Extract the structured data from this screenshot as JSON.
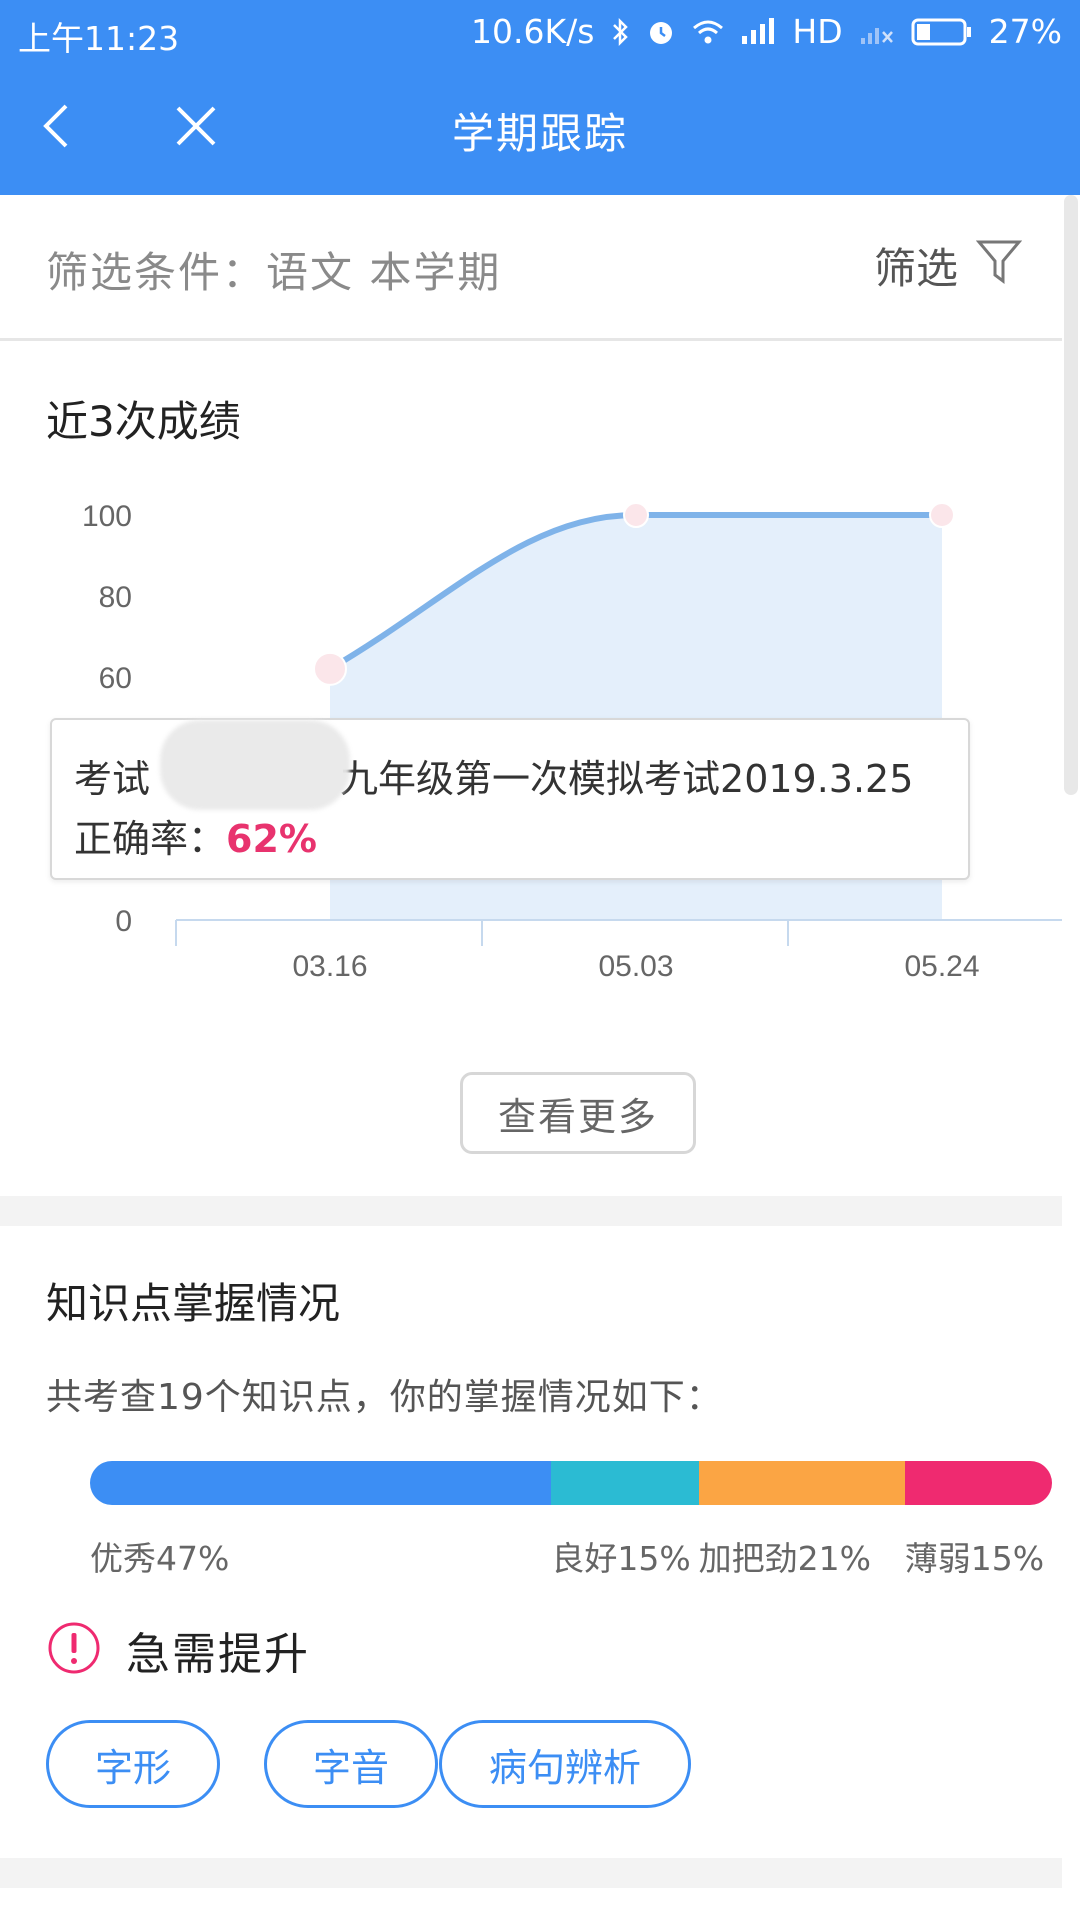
{
  "status_bar": {
    "time": "上午11:23",
    "network_speed": "10.6K/s",
    "hd": "HD",
    "battery": "27%"
  },
  "nav": {
    "title": "学期跟踪",
    "icons": [
      "back-icon",
      "close-icon"
    ]
  },
  "filter": {
    "text": "筛选条件：语文 本学期",
    "button_label": "筛选"
  },
  "recent_scores": {
    "title": "近3次成绩",
    "more_button": "查看更多",
    "tooltip": {
      "line1_prefix": "考试",
      "line1_suffix": "九年级第一次模拟考试2019.3.25",
      "line2_label": "正确率：",
      "line2_value": "62%"
    }
  },
  "chart_data": {
    "type": "area",
    "x": [
      "03.16",
      "05.03",
      "05.24"
    ],
    "values": [
      62,
      100,
      100
    ],
    "y_ticks": [
      "100",
      "80",
      "60",
      "0"
    ],
    "ylim": [
      0,
      100
    ],
    "grid": false,
    "colors": {
      "line": "#7fb3e9",
      "fill": "#e4effb",
      "point": "#fbe6ea",
      "axis": "#c6d9ee"
    }
  },
  "knowledge": {
    "title": "知识点掌握情况",
    "summary": "共考查19个知识点，你的掌握情况如下：",
    "segments": [
      {
        "label": "优秀47%",
        "percent": 47,
        "color": "#3c8ef4"
      },
      {
        "label": "良好15%",
        "percent": 15,
        "color": "#2bbbd3"
      },
      {
        "label": "加把劲21%",
        "percent": 21,
        "color": "#fba544"
      },
      {
        "label": "薄弱15%",
        "percent": 15,
        "color": "#ef2a70"
      }
    ]
  },
  "urgent": {
    "title": "急需提升",
    "tags": [
      "字形",
      "字音",
      "病句辨析"
    ]
  }
}
